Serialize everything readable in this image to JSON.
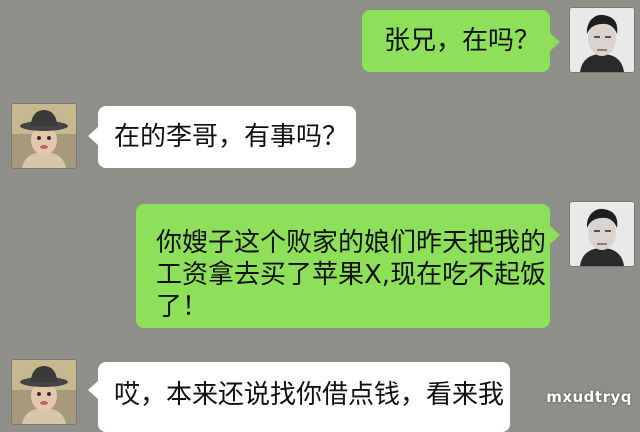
{
  "colors": {
    "background": "#8f8f8a",
    "outgoing_bubble": "#8ee05a",
    "incoming_bubble": "#ffffff"
  },
  "messages": [
    {
      "sender": "right",
      "avatar": "man-avatar",
      "text": "张兄，在吗？"
    },
    {
      "sender": "left",
      "avatar": "child-hat-avatar",
      "text": "在的李哥，有事吗？"
    },
    {
      "sender": "right",
      "avatar": "man-avatar",
      "lines": [
        "你嫂子这个败家的娘们昨天把我的",
        "工资拿去买了苹果X,现在吃不起饭",
        "了！"
      ]
    },
    {
      "sender": "left",
      "avatar": "child-hat-avatar",
      "text": "哎，本来还说找你借点钱，看来我"
    }
  ],
  "watermark": "mxudtryq"
}
